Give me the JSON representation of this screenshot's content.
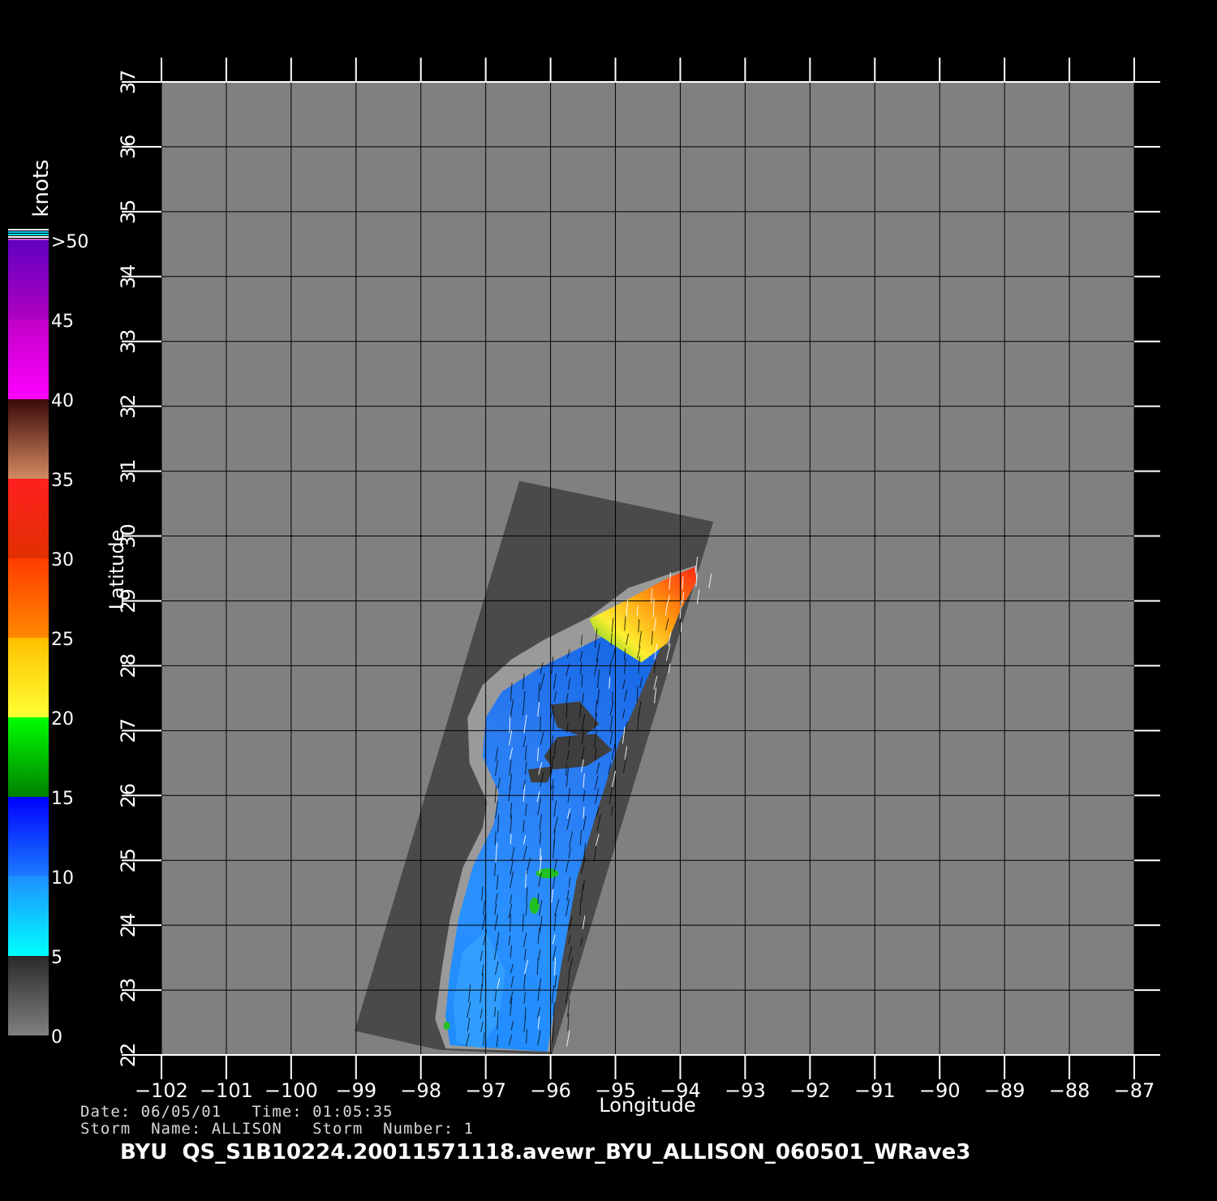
{
  "chart_data": {
    "type": "heatmap",
    "xlabel": "Longitude",
    "ylabel": "Latitude",
    "xlim": [
      -102,
      -87
    ],
    "ylim": [
      22,
      37
    ],
    "xticks": [
      -102,
      -101,
      -100,
      -99,
      -98,
      -97,
      -96,
      -95,
      -94,
      -93,
      -92,
      -91,
      -90,
      -89,
      -88,
      -87
    ],
    "yticks": [
      22,
      23,
      24,
      25,
      26,
      27,
      28,
      29,
      30,
      31,
      32,
      33,
      34,
      35,
      36,
      37
    ],
    "grid": true,
    "colorbar": {
      "unit": "knots",
      "labels": [
        "0",
        "5",
        "10",
        "15",
        "20",
        "25",
        "30",
        "35",
        "40",
        "45",
        ">50"
      ],
      "bands": [
        {
          "from": 0,
          "to": 5,
          "colors": [
            "#808080",
            "#2a2a2a"
          ]
        },
        {
          "from": 5,
          "to": 10,
          "colors": [
            "#00ffff",
            "#1e90ff"
          ]
        },
        {
          "from": 10,
          "to": 15,
          "colors": [
            "#1a7cff",
            "#0000ff"
          ]
        },
        {
          "from": 15,
          "to": 20,
          "colors": [
            "#008000",
            "#00ff00"
          ]
        },
        {
          "from": 20,
          "to": 25,
          "colors": [
            "#ffff33",
            "#ffc000"
          ]
        },
        {
          "from": 25,
          "to": 30,
          "colors": [
            "#ff8800",
            "#ff3c00"
          ]
        },
        {
          "from": 30,
          "to": 35,
          "colors": [
            "#e13000",
            "#ff2020"
          ]
        },
        {
          "from": 35,
          "to": 40,
          "colors": [
            "#d48a60",
            "#3a0a0a"
          ]
        },
        {
          "from": 40,
          "to": 45,
          "colors": [
            "#ff00ff",
            "#c000c8"
          ]
        },
        {
          "from": 45,
          "to": 50,
          "colors": [
            "#b000c0",
            "#6000c0"
          ]
        }
      ]
    },
    "colors": {
      "background": "#000000",
      "land": "#808080",
      "swath": "#4a4a4a",
      "coast": "#9a9a9a",
      "grid": "#000000",
      "ticks": "#ffffff",
      "vectors_light": "#ffffff",
      "vectors_dark": "#000000"
    }
  },
  "info": {
    "date_time": "Date: 06/05/01   Time: 01:05:35",
    "storm": "Storm  Name: ALLISON   Storm  Number: 1"
  },
  "title": "BYU  QS_S1B10224.20011571118.avewr_BYU_ALLISON_060501_WRave3"
}
